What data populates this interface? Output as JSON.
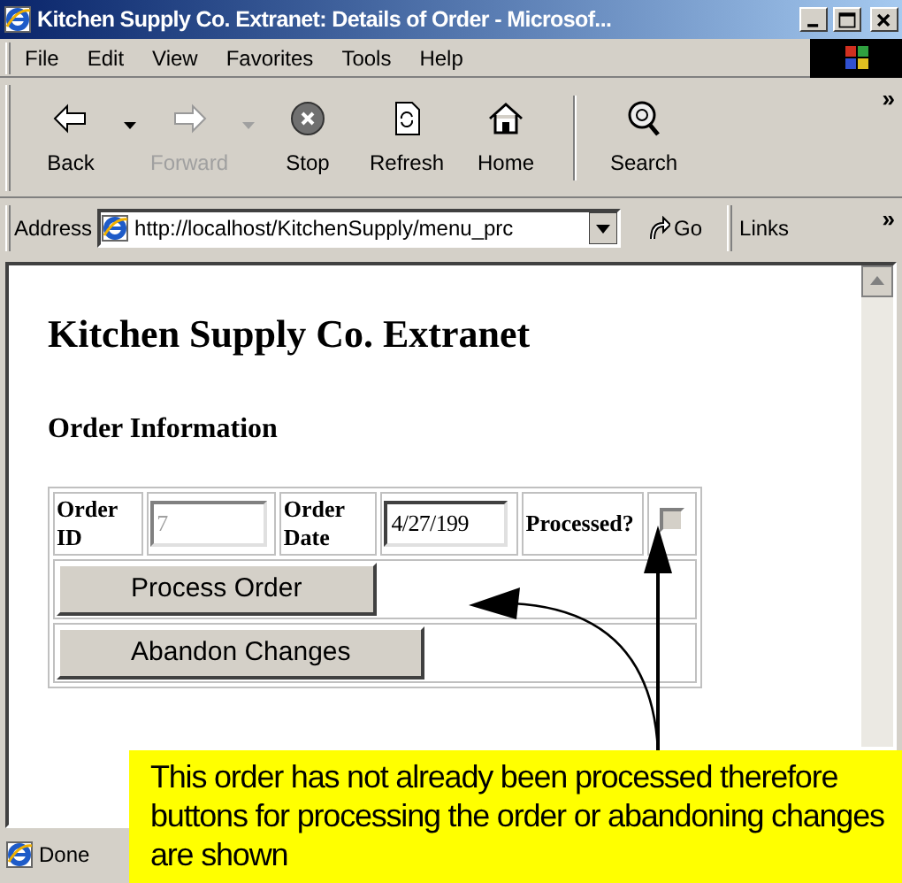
{
  "window": {
    "title": "Kitchen Supply Co. Extranet: Details of Order - Microsof..."
  },
  "menu": [
    "File",
    "Edit",
    "View",
    "Favorites",
    "Tools",
    "Help"
  ],
  "toolbar": [
    {
      "kind": "back",
      "label": "Back",
      "disabled": false,
      "dropdown": true
    },
    {
      "kind": "forward",
      "label": "Forward",
      "disabled": true,
      "dropdown": true
    },
    {
      "kind": "stop",
      "label": "Stop",
      "disabled": false,
      "dropdown": false
    },
    {
      "kind": "refresh",
      "label": "Refresh",
      "disabled": false,
      "dropdown": false
    },
    {
      "kind": "home",
      "label": "Home",
      "disabled": false,
      "dropdown": false
    },
    {
      "kind": "search",
      "label": "Search",
      "disabled": false,
      "dropdown": false
    }
  ],
  "toolbar_more": "»",
  "address": {
    "label": "Address",
    "url": "http://localhost/KitchenSupply/menu_prc",
    "go": "Go",
    "links": "Links",
    "links_more": "»"
  },
  "page": {
    "heading": "Kitchen Supply Co. Extranet",
    "subheading": "Order Information",
    "order_id": {
      "label": "Order ID",
      "value": "7",
      "disabled": true
    },
    "order_date": {
      "label": "Order Date",
      "value": "4/27/199",
      "disabled": false
    },
    "processed": {
      "label": "Processed?",
      "checked": false
    },
    "buttons": [
      "Process Order",
      "Abandon Changes"
    ]
  },
  "status_bar": {
    "text": "Done"
  },
  "callout": {
    "text": "This order has not already been processed therefore buttons for processing the order or abandoning changes are shown"
  }
}
